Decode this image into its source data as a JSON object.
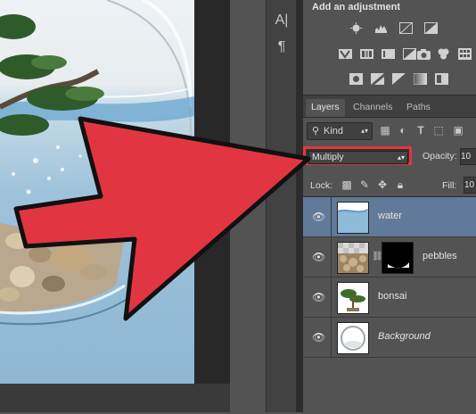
{
  "adjustments_panel": {
    "title": "Add an adjustment",
    "row1": [
      "brightness-contrast-icon",
      "levels-icon",
      "curves-icon",
      "exposure-icon"
    ],
    "row2": [
      "vibrance-icon",
      "hue-saturation-icon",
      "color-balance-icon",
      "black-white-icon",
      "photo-filter-icon",
      "channel-mixer-icon",
      "color-lookup-icon"
    ],
    "row3": [
      "invert-icon",
      "posterize-icon",
      "threshold-icon",
      "gradient-map-icon",
      "selective-color-icon"
    ]
  },
  "tool_strip": {
    "character": "A|",
    "paragraph": "¶"
  },
  "layers_panel": {
    "tabs": [
      "Layers",
      "Channels",
      "Paths"
    ],
    "active_tab": "Layers",
    "filter_kind": "Kind",
    "blend_mode": "Multiply",
    "opacity_label": "Opacity:",
    "opacity_value": "10",
    "lock_label": "Lock:",
    "fill_label": "Fill:",
    "fill_value": "10",
    "layers": [
      {
        "name": "water",
        "selected": true
      },
      {
        "name": "pebbles",
        "selected": false
      },
      {
        "name": "bonsai",
        "selected": false
      },
      {
        "name": "Background",
        "selected": false
      }
    ]
  },
  "colors": {
    "highlight_red": "#e23542",
    "selected_layer": "#627a99",
    "panel_bg": "#535353"
  }
}
